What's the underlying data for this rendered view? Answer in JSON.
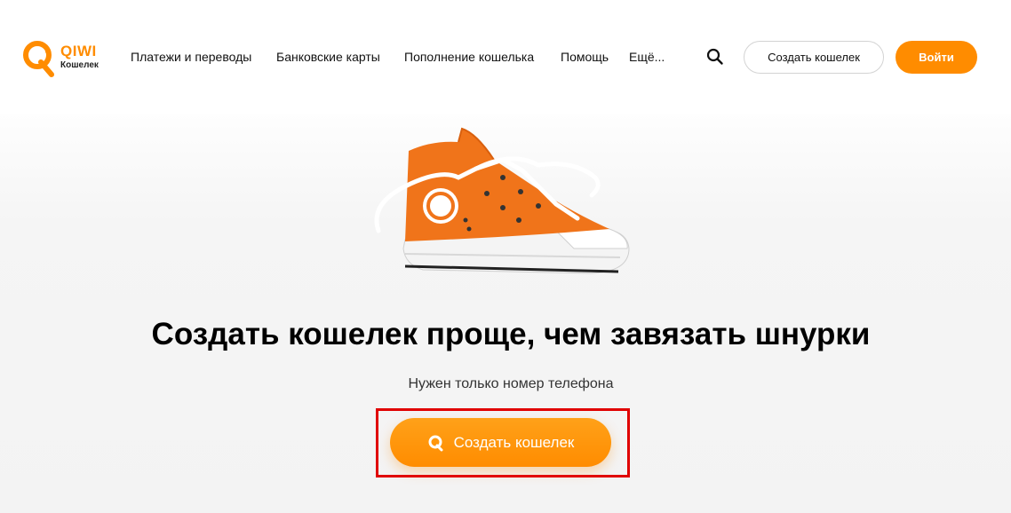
{
  "brand": {
    "wordmark": "QIWI",
    "sub": "Кошелек",
    "accent_color": "#ff8c00"
  },
  "nav": {
    "items": [
      "Платежи и переводы",
      "Банковские карты",
      "Пополнение кошелька",
      "Помощь",
      "Ещё..."
    ]
  },
  "header_actions": {
    "search_icon": "search-icon",
    "create_wallet_label": "Создать кошелек",
    "login_label": "Войти"
  },
  "hero": {
    "image": "orange-sneaker",
    "title": "Создать кошелек проще, чем завязать шнурки",
    "subtitle": "Нужен только номер телефона",
    "cta_label": "Создать кошелек",
    "cta_icon": "qiwi-logo-icon",
    "highlight_color": "#e00000"
  }
}
